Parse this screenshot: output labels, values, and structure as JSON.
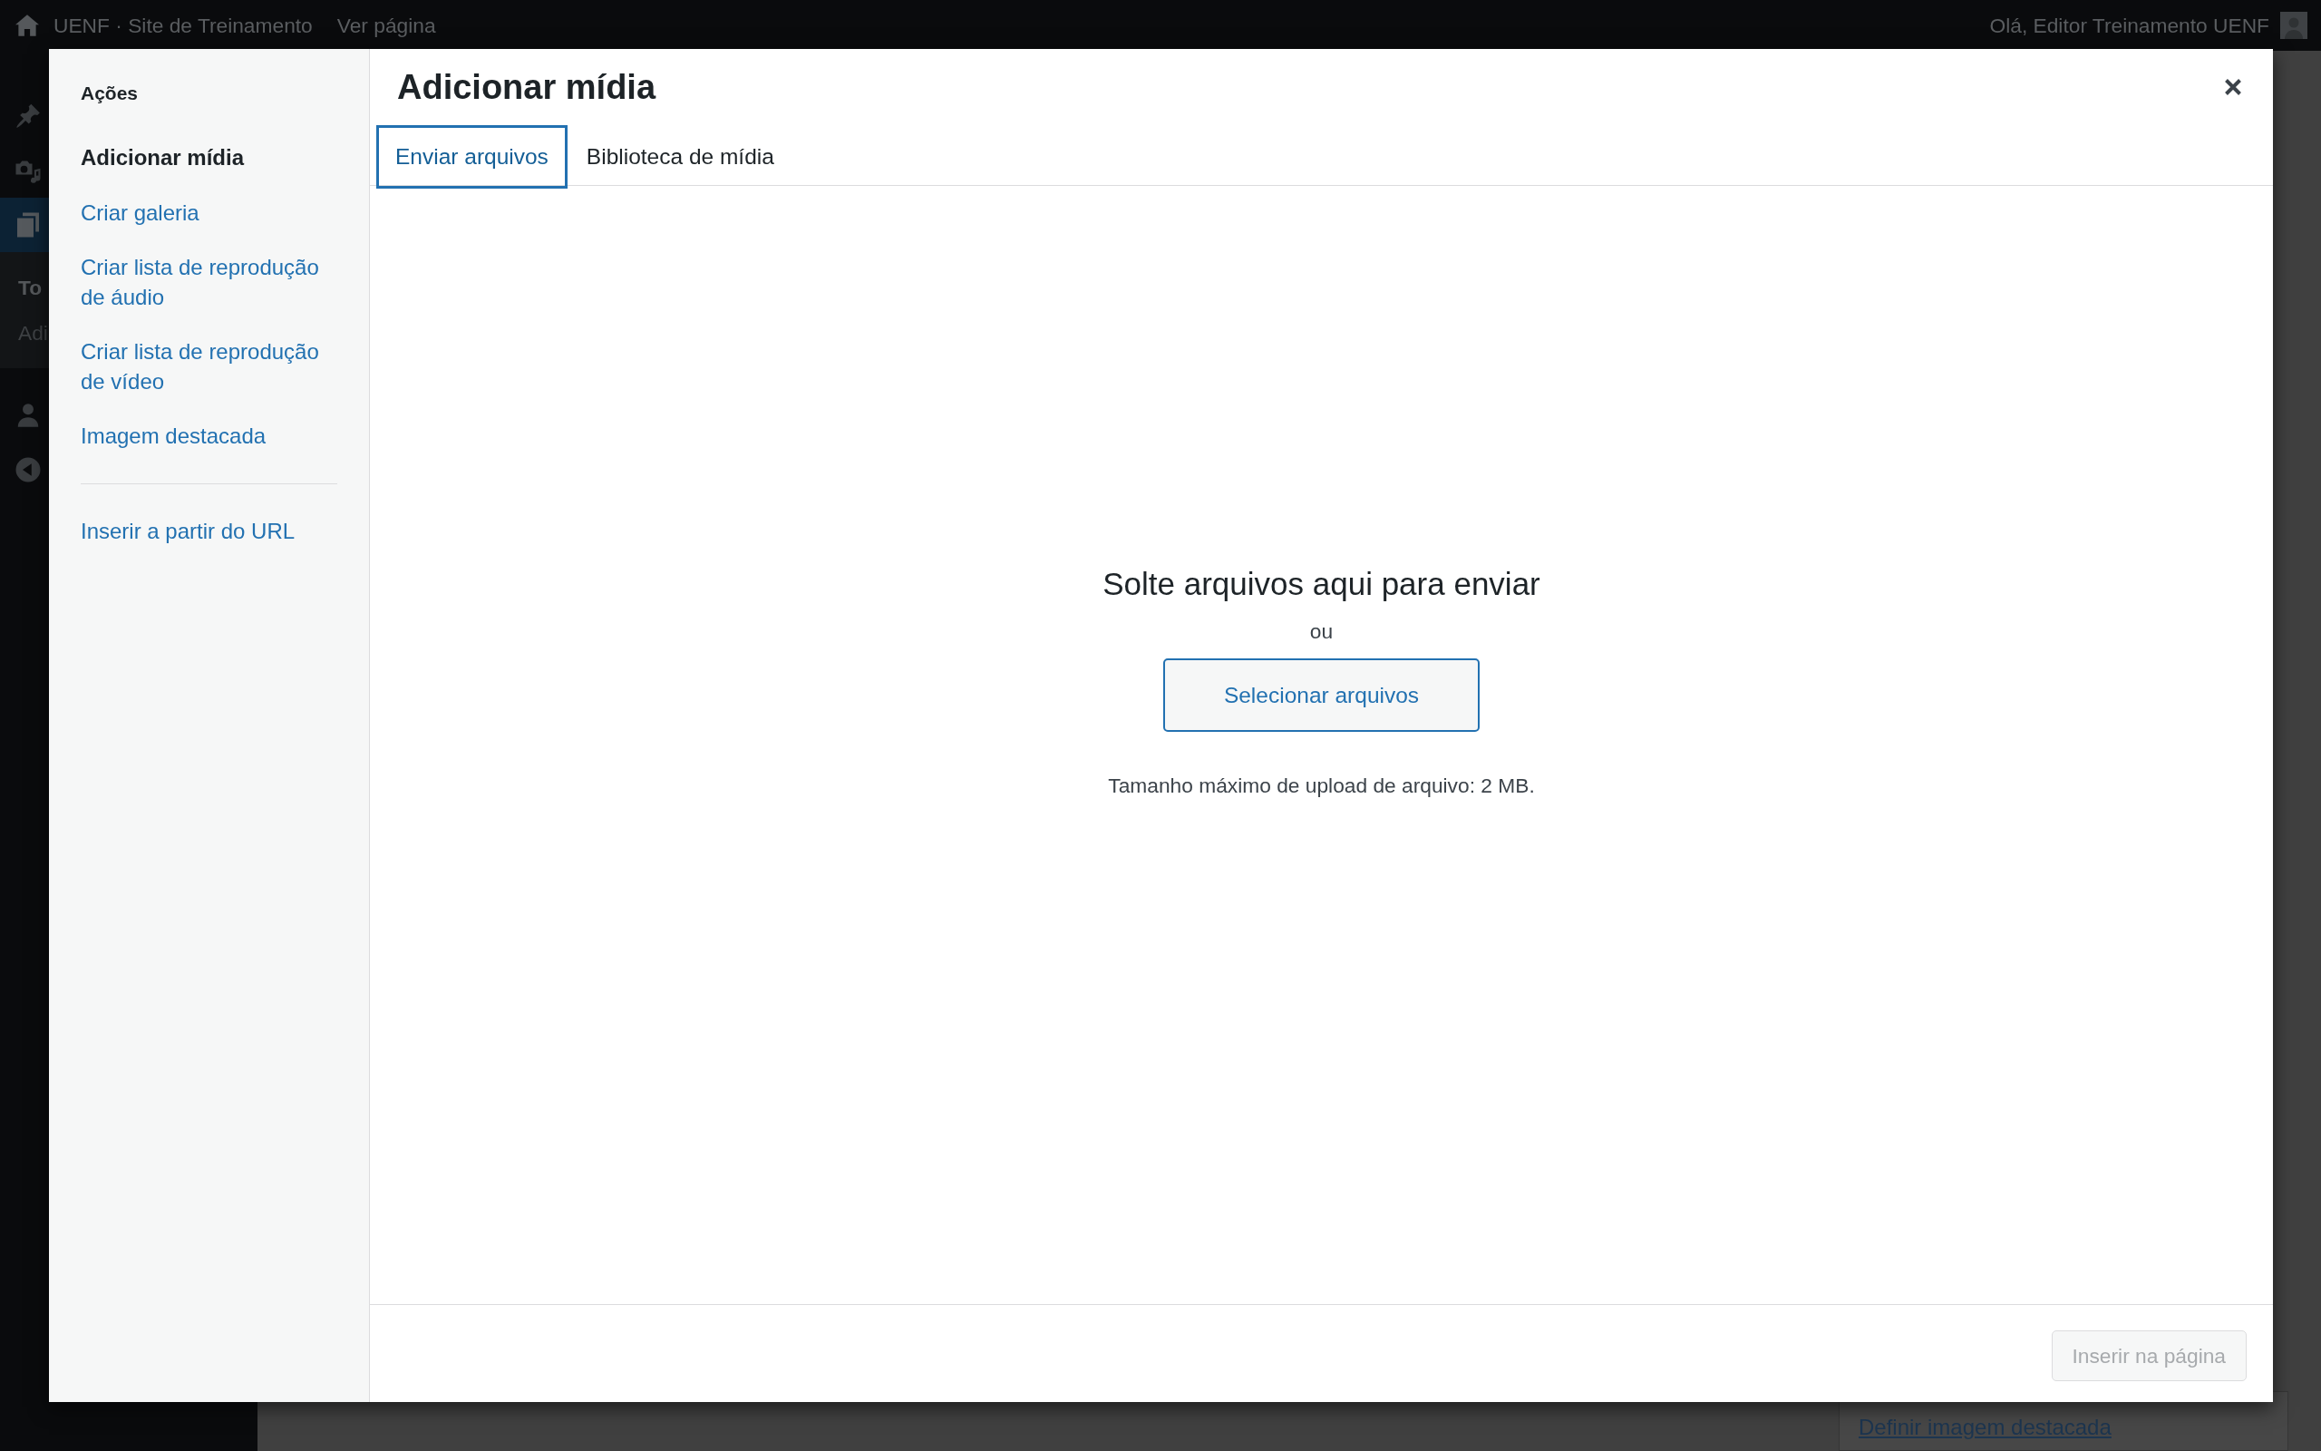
{
  "admin_bar": {
    "site_name": "UENF · Site de Treinamento",
    "view_link": "Ver página",
    "greeting": "Olá, Editor Treinamento UENF"
  },
  "admin_menu": [
    {
      "selected": false
    },
    {
      "selected": false
    },
    {
      "selected": true,
      "submenu": [
        {
          "label": "To",
          "selected": true
        },
        {
          "label": "Adi",
          "selected": false
        }
      ]
    },
    {
      "selected": false
    },
    {
      "selected": false
    }
  ],
  "meta_box": {
    "link": "Definir imagem destacada"
  },
  "modal": {
    "title": "Adicionar mídia",
    "sidebar": {
      "heading": "Ações",
      "groups": [
        {
          "items": [
            {
              "label": "Adicionar mídia",
              "selected": true
            },
            {
              "label": "Criar galeria",
              "selected": false
            },
            {
              "label": "Criar lista de reprodução de áudio",
              "selected": false
            },
            {
              "label": "Criar lista de reprodução de vídeo",
              "selected": false
            },
            {
              "label": "Imagem destacada",
              "selected": false
            }
          ]
        },
        {
          "items": [
            {
              "label": "Inserir a partir do URL",
              "selected": false
            }
          ]
        }
      ]
    },
    "tabs": [
      {
        "label": "Enviar arquivos",
        "selected": true
      },
      {
        "label": "Biblioteca de mídia",
        "selected": false
      }
    ],
    "uploader": {
      "heading": "Solte arquivos aqui para enviar",
      "or_text": "ou",
      "button": "Selecionar arquivos",
      "note": "Tamanho máximo de upload de arquivo: 2 MB."
    },
    "footer": {
      "button": {
        "label": "Inserir na página",
        "disabled": true
      }
    }
  }
}
